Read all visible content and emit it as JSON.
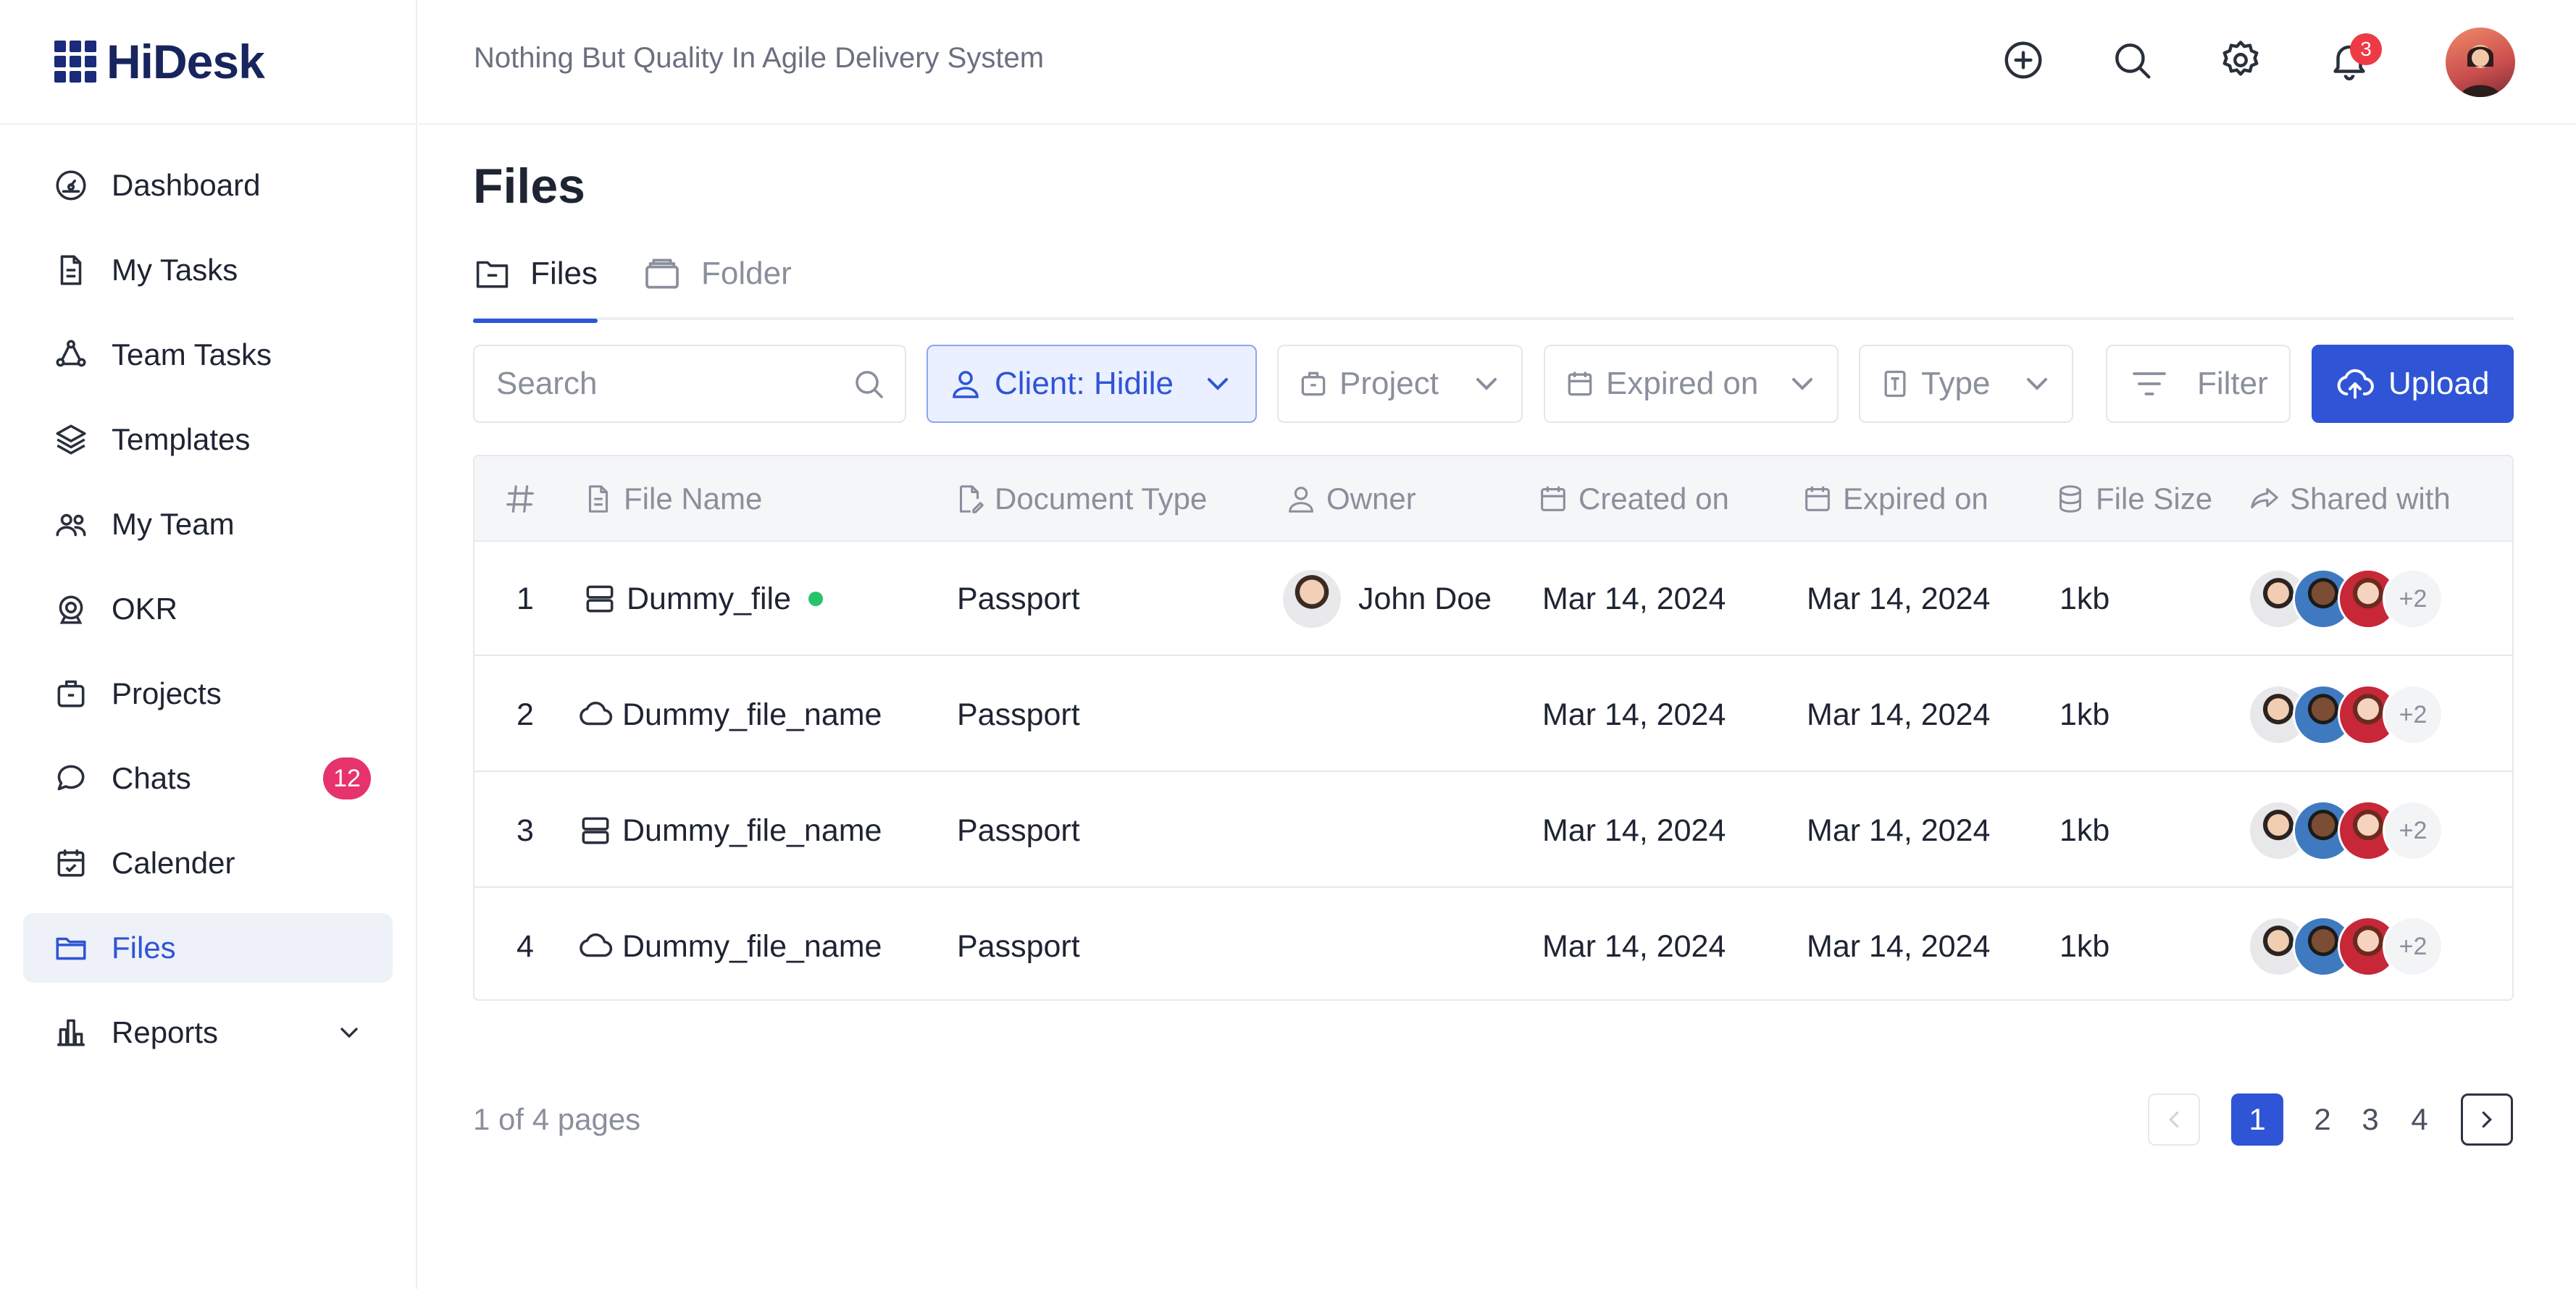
{
  "app": {
    "brand": "HiDesk",
    "tagline": "Nothing But Quality In Agile Delivery System"
  },
  "colors": {
    "accent": "#2f54d6",
    "badge": "#e6336b",
    "online": "#27c46a",
    "notification": "#ee3a44"
  },
  "header": {
    "icons": [
      "plus-circle-icon",
      "search-icon",
      "gear-icon",
      "bell-icon"
    ],
    "notifications": "3"
  },
  "sidebar": {
    "items": [
      {
        "label": "Dashboard",
        "icon": "dashboard-gauge-icon"
      },
      {
        "label": "My Tasks",
        "icon": "document-icon"
      },
      {
        "label": "Team Tasks",
        "icon": "team-tasks-icon"
      },
      {
        "label": "Templates",
        "icon": "layers-icon"
      },
      {
        "label": "My Team",
        "icon": "users-icon"
      },
      {
        "label": "OKR",
        "icon": "target-icon"
      },
      {
        "label": "Projects",
        "icon": "briefcase-icon"
      },
      {
        "label": "Chats",
        "icon": "chat-icon",
        "badge": "12"
      },
      {
        "label": "Calender",
        "icon": "calendar-check-icon"
      },
      {
        "label": "Files",
        "icon": "folder-icon",
        "active": true
      },
      {
        "label": "Reports",
        "icon": "bar-chart-icon"
      }
    ]
  },
  "page": {
    "title": "Files"
  },
  "tabs": [
    {
      "label": "Files",
      "active": true
    },
    {
      "label": "Folder",
      "active": false
    }
  ],
  "toolbar": {
    "search_placeholder": "Search",
    "client_label": "Client: Hidile",
    "project_label": "Project",
    "expired_label": "Expired on",
    "type_label": "Type",
    "filter_label": "Filter",
    "upload_label": "Upload"
  },
  "table": {
    "headers": [
      "File Name",
      "Document Type",
      "Owner",
      "Created on",
      "Expired on",
      "File Size",
      "Shared with"
    ],
    "rows": [
      {
        "num": "1",
        "name": "Dummy_file",
        "icon": "server-icon",
        "online": true,
        "doc_type": "Passport",
        "owner": "John Doe",
        "created": "Mar 14, 2024",
        "expired": "Mar 14, 2024",
        "size": "1kb",
        "shared_more": "+2"
      },
      {
        "num": "2",
        "name": "Dummy_file_name",
        "icon": "cloud-icon",
        "online": false,
        "doc_type": "Passport",
        "owner": "",
        "created": "Mar 14, 2024",
        "expired": "Mar 14, 2024",
        "size": "1kb",
        "shared_more": "+2"
      },
      {
        "num": "3",
        "name": "Dummy_file_name",
        "icon": "server-icon",
        "online": false,
        "doc_type": "Passport",
        "owner": "",
        "created": "Mar 14, 2024",
        "expired": "Mar 14, 2024",
        "size": "1kb",
        "shared_more": "+2"
      },
      {
        "num": "4",
        "name": "Dummy_file_name",
        "icon": "cloud-icon",
        "online": false,
        "doc_type": "Passport",
        "owner": "",
        "created": "Mar 14, 2024",
        "expired": "Mar 14, 2024",
        "size": "1kb",
        "shared_more": "+2"
      }
    ]
  },
  "pagination": {
    "summary": "1 of 4 pages",
    "pages": [
      "1",
      "2",
      "3",
      "4"
    ],
    "current": "1"
  }
}
